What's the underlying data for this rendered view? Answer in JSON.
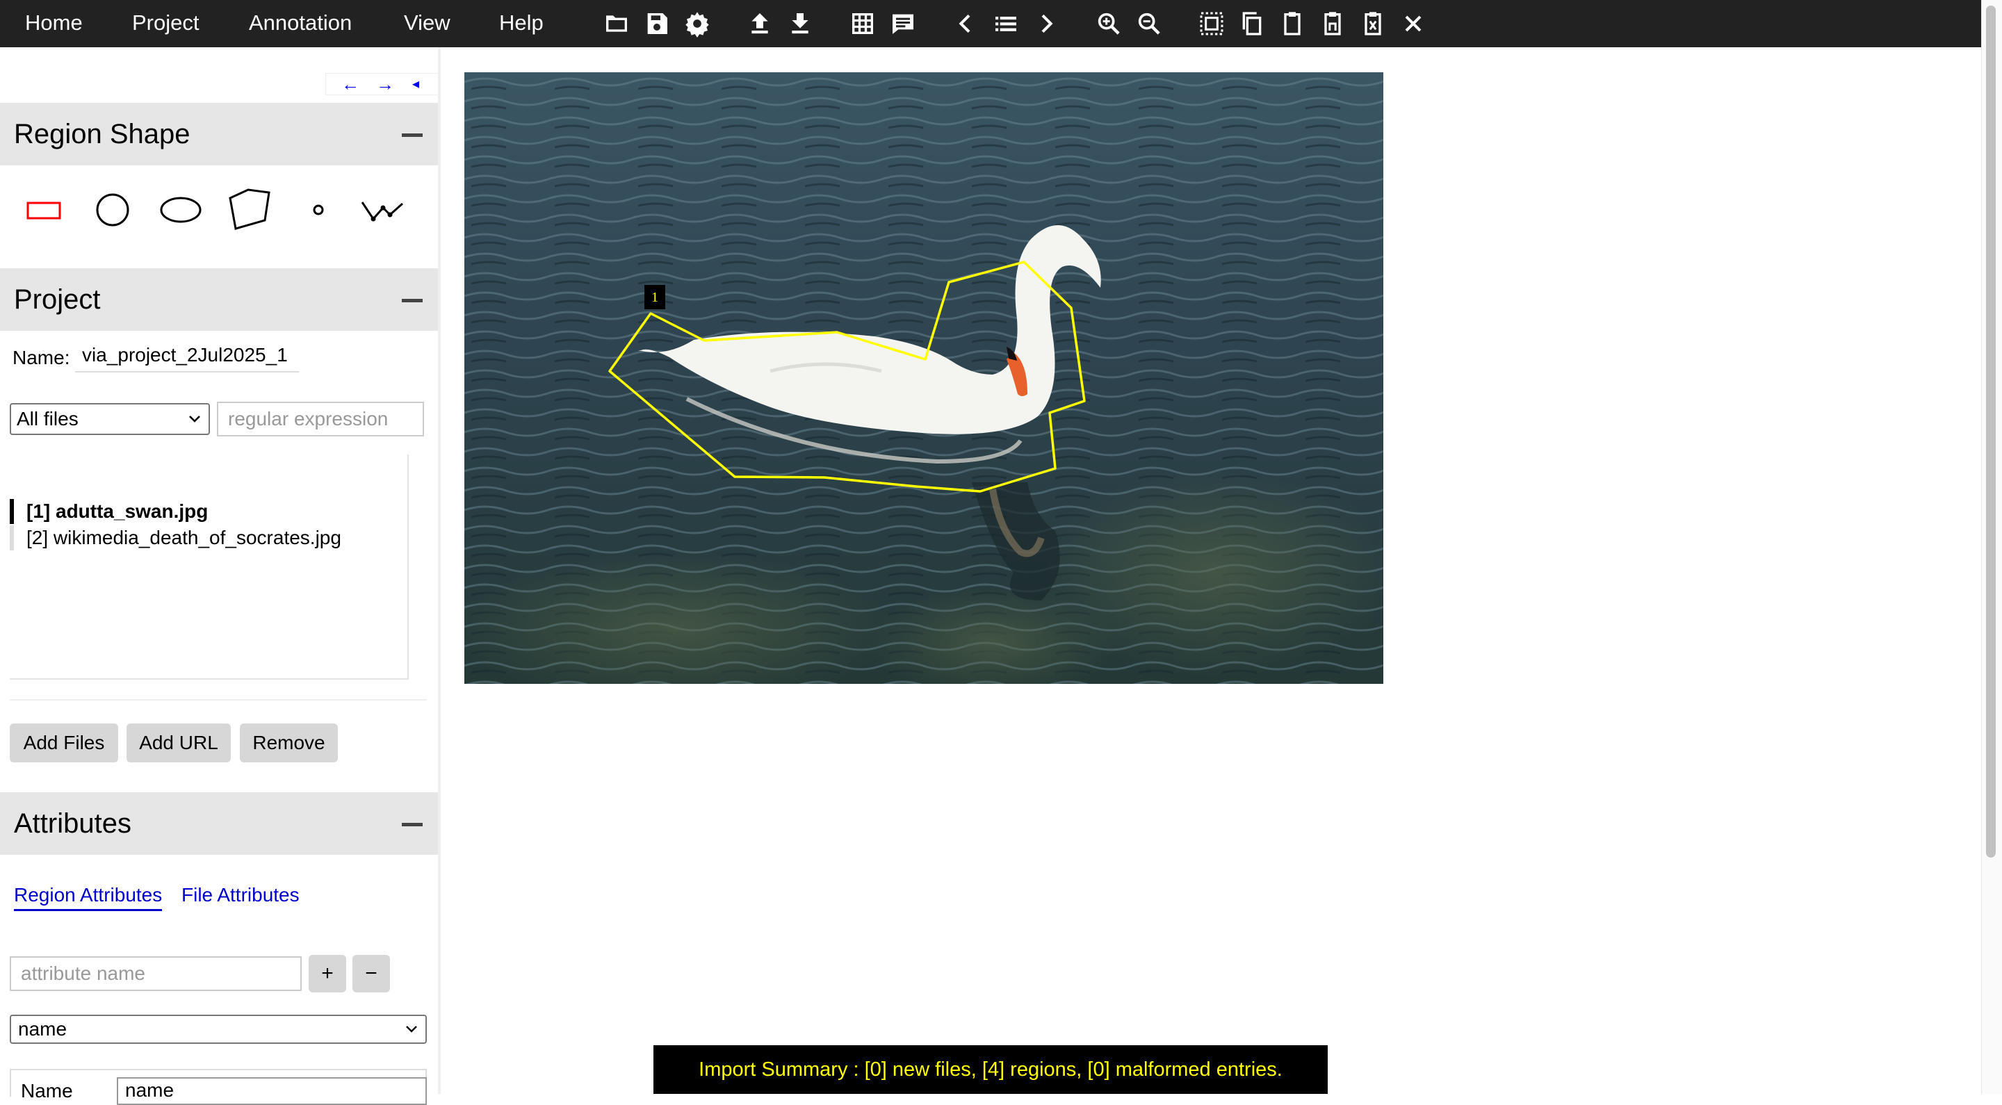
{
  "menu": {
    "home": "Home",
    "project": "Project",
    "annotation": "Annotation",
    "view": "View",
    "help": "Help"
  },
  "toolbar_icons": [
    "folder-open-icon",
    "save-icon",
    "settings-icon",
    "upload-icon",
    "download-icon",
    "grid-view-icon",
    "comment-icon",
    "prev-image-icon",
    "list-icon",
    "next-image-icon",
    "zoom-in-icon",
    "zoom-out-icon",
    "select-all-icon",
    "copy-icon",
    "paste-icon",
    "paste-n-icon",
    "paste-delete-icon",
    "close-icon"
  ],
  "nav": {
    "prev": "←",
    "next": "→",
    "collapse": "◂"
  },
  "region_shape": {
    "title": "Region Shape",
    "shapes": [
      "rectangle",
      "circle",
      "ellipse",
      "polygon",
      "point",
      "polyline"
    ],
    "selected": "rectangle",
    "selected_color": "#ff0000"
  },
  "project": {
    "title": "Project",
    "name_label": "Name:",
    "name_value": "via_project_2Jul2025_1",
    "filter_selected": "All files",
    "regex_placeholder": "regular expression",
    "files": [
      {
        "label": "[1] adutta_swan.jpg",
        "active": true
      },
      {
        "label": "[2] wikimedia_death_of_socrates.jpg",
        "active": false
      }
    ],
    "add_files": "Add Files",
    "add_url": "Add URL",
    "remove": "Remove"
  },
  "attributes": {
    "title": "Attributes",
    "tab_region": "Region Attributes",
    "tab_file": "File Attributes",
    "name_placeholder": "attribute name",
    "add": "+",
    "remove": "−",
    "selected_attribute": "name",
    "row_label": "Name",
    "row_value": "name"
  },
  "canvas": {
    "region_label": "1",
    "region_color": "#ffff00"
  },
  "status": {
    "import_summary": "Import Summary : [0] new files, [4] regions, [0] malformed entries."
  }
}
